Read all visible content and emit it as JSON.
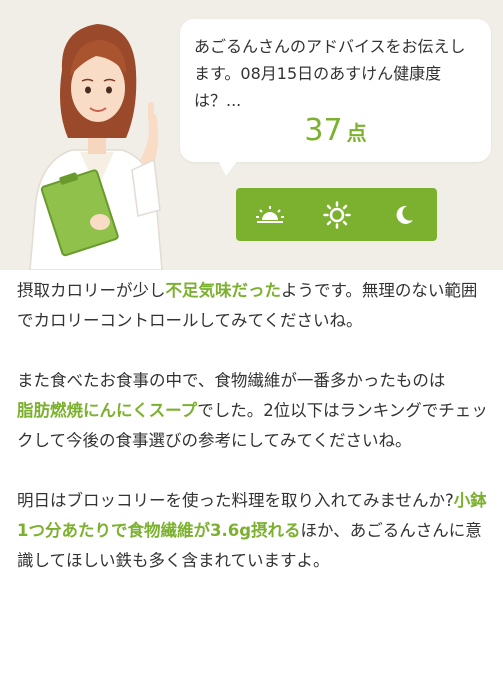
{
  "advice": {
    "intro": "あごるんさんのアドバイスをお伝えします。08月15日のあすけん健康度は？...",
    "score": "37",
    "score_unit": "点"
  },
  "time_of_day": {
    "morning_icon": "sunrise-icon",
    "noon_icon": "sun-icon",
    "night_icon": "moon-icon"
  },
  "colors": {
    "accent": "#7cb130",
    "hero_bg": "#f1ede7",
    "text": "#333333"
  },
  "paragraphs": {
    "p1": {
      "a": "摂取カロリーが少し",
      "b": "不足気味だった",
      "c": "ようです。無理のない範囲でカロリーコントロールしてみてくださいね。"
    },
    "p2": {
      "a": "また食べたお食事の中で、食物繊維が一番多かったものは",
      "b": "脂肪燃焼にんにくスープ",
      "c": "でした。2位以下はランキングでチェックして今後の食事選びの参考にしてみてくださいね。"
    },
    "p3": {
      "a": "明日はブロッコリーを使った料理を取り入れてみませんか?",
      "b": "小鉢1つ分あたりで食物繊維が3.6g摂れる",
      "c": "ほか、あごるんさんに意識してほしい鉄も多く含まれていますよ。"
    }
  }
}
